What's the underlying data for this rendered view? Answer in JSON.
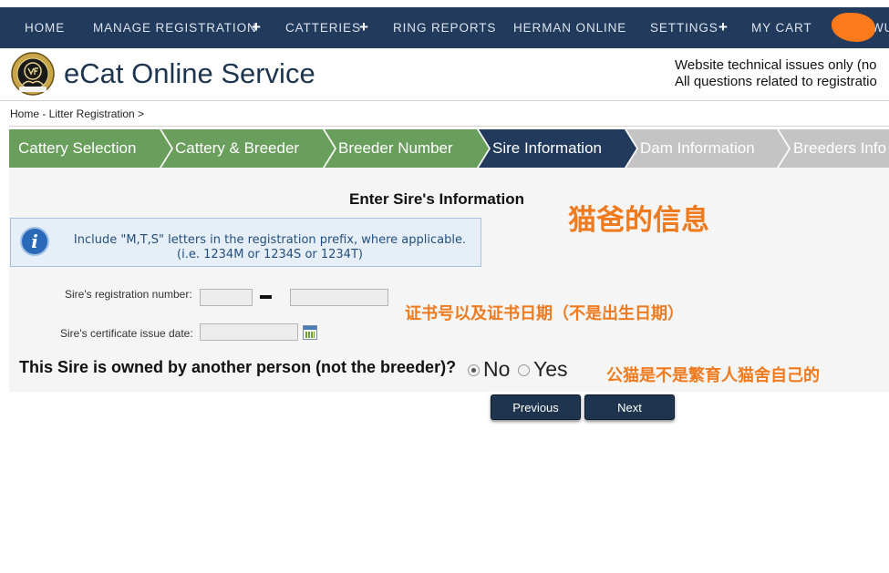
{
  "nav": {
    "home": "HOME",
    "manage_registration": "MANAGE REGISTRATION",
    "catteries": "CATTERIES",
    "ring_reports": "RING REPORTS",
    "herman_online": "HERMAN ONLINE",
    "settings": "SETTINGS",
    "my_cart": "MY CART",
    "plus": "+",
    "user_partial": "WU",
    "bar_color": "#223a5c"
  },
  "header": {
    "title": "eCat Online Service",
    "notice_line1": "Website technical issues only (no",
    "notice_line2": "All questions related to registratio"
  },
  "breadcrumb": "Home - Litter Registration >",
  "steps": [
    {
      "label": "Cattery Selection",
      "state": "completed"
    },
    {
      "label": "Cattery & Breeder",
      "state": "completed"
    },
    {
      "label": "Breeder Number",
      "state": "completed"
    },
    {
      "label": "Sire Information",
      "state": "current"
    },
    {
      "label": "Dam Information",
      "state": "upcoming"
    },
    {
      "label": "Breeders Info",
      "state": "upcoming"
    }
  ],
  "step_colors": {
    "completed": "#6a9e5d",
    "current": "#223a5c",
    "upcoming": "#c4c4c4"
  },
  "form": {
    "title": "Enter Sire's Information",
    "info_line1": "Include \"M,T,S\" letters in the registration prefix, where applicable.",
    "info_line2": "(i.e. 1234M or 1234S or 1234T)",
    "reg_label": "Sire's registration number:",
    "reg_prefix_value": "",
    "reg_number_value": "",
    "cert_label": "Sire's certificate issue date:",
    "cert_date_value": "",
    "owner_question": "This Sire is owned by another person (not the breeder)?",
    "option_no": "No",
    "option_yes": "Yes",
    "selected_option": "No"
  },
  "annotations": {
    "sire_info": "猫爸的信息",
    "cert_note": "证书号以及证书日期（不是出生日期）",
    "owner_note": "公猫是不是繁育人猫舍自己的",
    "color": "#f07a1e"
  },
  "buttons": {
    "previous": "Previous",
    "next": "Next"
  }
}
